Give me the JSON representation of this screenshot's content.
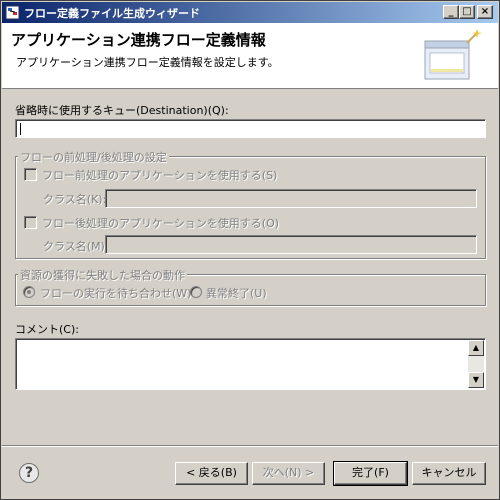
{
  "window": {
    "title": "フロー定義ファイル生成ウィザード",
    "icons": [
      "app-icon",
      "minimize-icon",
      "maximize-icon",
      "close-icon"
    ],
    "controls": {
      "minimize": "_",
      "maximize": "□",
      "close": "×"
    }
  },
  "header": {
    "title": "アプリケーション連携フロー定義情報",
    "description": "アプリケーション連携フロー定義情報を設定します。"
  },
  "form": {
    "default_queue_label": "省略時に使用するキュー(Destination)(Q):",
    "default_queue_value": "",
    "flow_processing": {
      "title": "フローの前処理/後処理の設定",
      "pre_checkbox_label": "フロー前処理のアプリケーションを使用する(S)",
      "pre_class_label": "クラス名(K):",
      "pre_class_value": "",
      "post_checkbox_label": "フロー後処理のアプリケーションを使用する(O)",
      "post_class_label": "クラス名(M):",
      "post_class_value": ""
    },
    "resource_failure": {
      "title": "資源の獲得に失敗した場合の動作",
      "option_wait": "フローの実行を待ち合わせ(W)",
      "option_abend": "異常終了(U)",
      "selected": "フローの実行を待ち合わせ(W)"
    },
    "comment_label": "コメント(C):",
    "comment_value": ""
  },
  "buttons": {
    "help": "?",
    "back": "< 戻る(B)",
    "next": "次へ(N) >",
    "finish": "完了(F)",
    "cancel": "キャンセル"
  },
  "colors": {
    "titlebar_start": "#0a246a",
    "titlebar_end": "#a6caf0",
    "dialog_bg": "#d4d0c8"
  }
}
